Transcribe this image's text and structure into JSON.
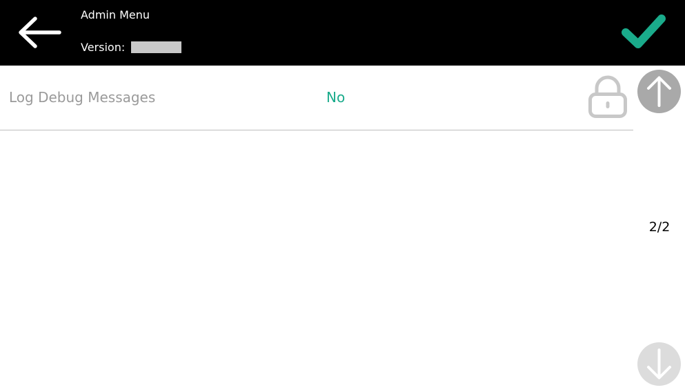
{
  "header": {
    "title": "Admin Menu",
    "version_label": "Version:",
    "back_icon": "arrow-left-icon",
    "confirm_icon": "checkmark-icon"
  },
  "settings": [
    {
      "label": "Log Debug Messages",
      "value": "No",
      "locked": true,
      "lock_icon": "lock-icon"
    }
  ],
  "pagination": {
    "indicator": "2/2",
    "up_icon": "arrow-up-icon",
    "down_icon": "arrow-down-icon"
  },
  "colors": {
    "header_bg": "#000000",
    "accent": "#1aab8b",
    "value_text": "#1aab8b",
    "label_text": "#9a9a9a",
    "disabled_icon": "#c8c8c8",
    "scroll_up": "#a9a9a9",
    "scroll_down": "#dcdcdc"
  }
}
